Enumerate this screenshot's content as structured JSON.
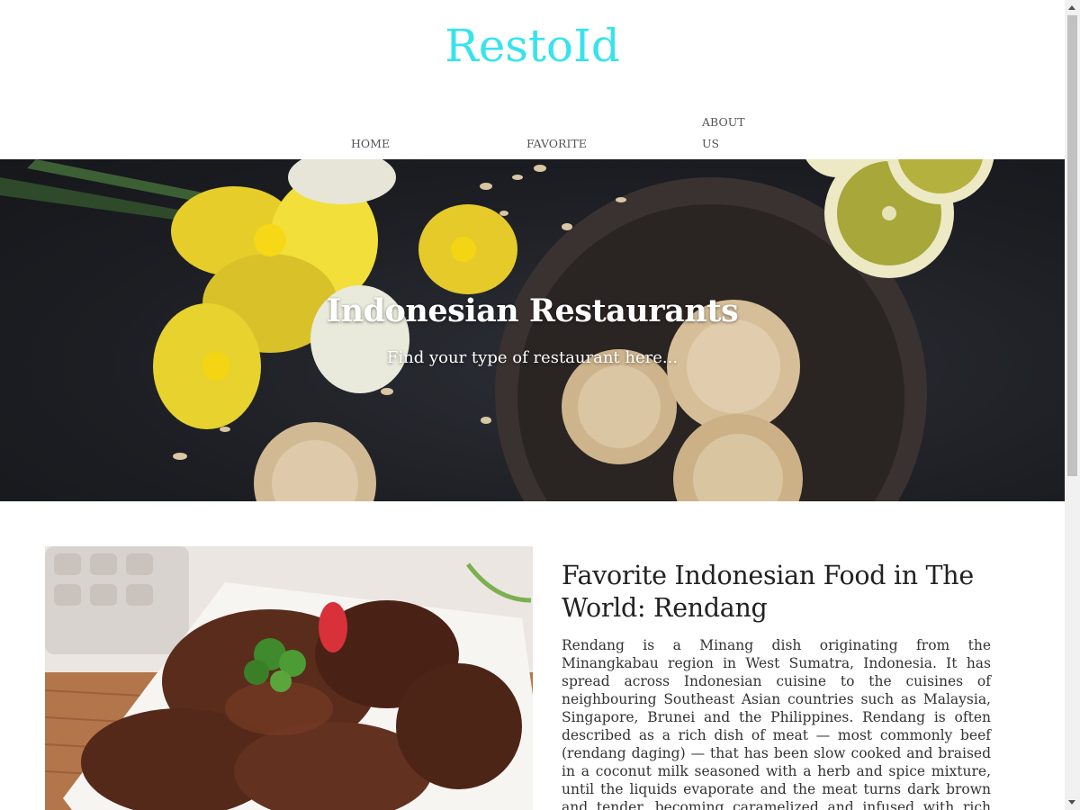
{
  "header": {
    "brand": "RestoId",
    "nav": [
      {
        "label": "HOME"
      },
      {
        "label": "FAVORITE"
      },
      {
        "label": "ABOUT US"
      }
    ]
  },
  "hero": {
    "title": "Indonesian Restaurants",
    "subtitle": "Find your type of restaurant here..."
  },
  "article": {
    "title": "Favorite Indonesian Food in The World: Rendang",
    "body": "Rendang is a Minang dish originating from the Minangkabau region in West Sumatra, Indonesia. It has spread across Indonesian cuisine to the cuisines of neighbouring Southeast Asian countries such as Malaysia, Singapore, Brunei and the Philippines. Rendang is often described as a rich dish of meat — most commonly beef (rendang daging) — that has been slow cooked and braised in a coconut milk seasoned with a herb and spice mixture, until the liquids evaporate and the meat turns dark brown and tender, becoming caramelized and infused with rich flavours."
  },
  "colors": {
    "brand": "#38e3ec",
    "hero_background": "#1c1e23",
    "text": "#222222"
  },
  "icons": {
    "scroll_up": "triangle-up-icon",
    "scroll_down": "triangle-down-icon"
  }
}
